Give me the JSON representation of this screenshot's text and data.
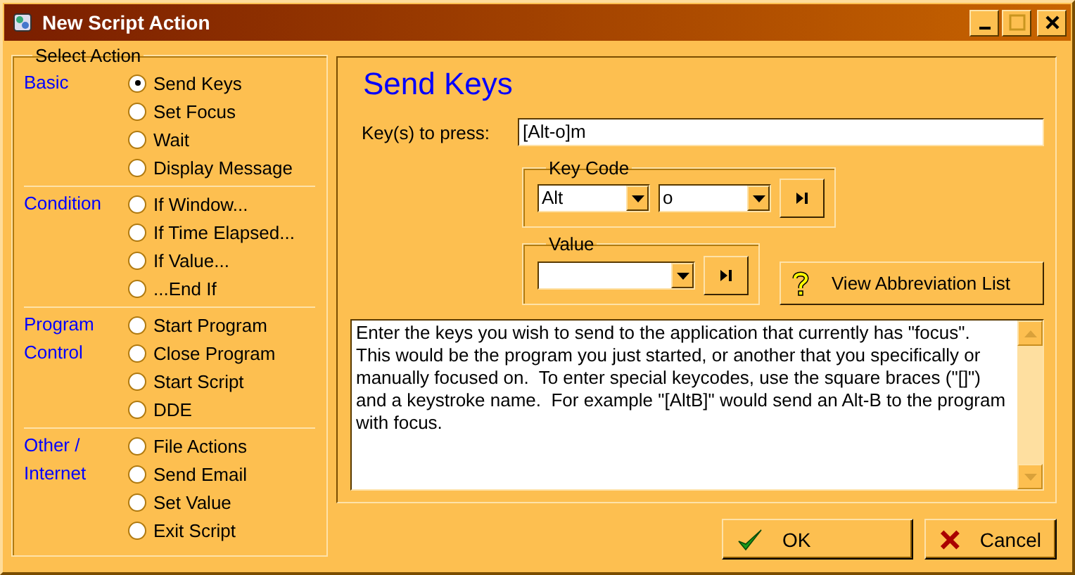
{
  "window": {
    "title": "New Script Action"
  },
  "action_group": {
    "label": "Select Action",
    "sections": [
      {
        "label_lines": [
          "Basic"
        ],
        "options": [
          {
            "label": "Send Keys",
            "selected": true
          },
          {
            "label": "Set Focus",
            "selected": false
          },
          {
            "label": "Wait",
            "selected": false
          },
          {
            "label": "Display Message",
            "selected": false
          }
        ]
      },
      {
        "label_lines": [
          "Condition"
        ],
        "options": [
          {
            "label": "If Window...",
            "selected": false
          },
          {
            "label": "If Time Elapsed...",
            "selected": false
          },
          {
            "label": "If Value...",
            "selected": false
          },
          {
            "label": "...End If",
            "selected": false
          }
        ]
      },
      {
        "label_lines": [
          "Program",
          "Control"
        ],
        "options": [
          {
            "label": "Start Program",
            "selected": false
          },
          {
            "label": "Close Program",
            "selected": false
          },
          {
            "label": "Start Script",
            "selected": false
          },
          {
            "label": "DDE",
            "selected": false
          }
        ]
      },
      {
        "label_lines": [
          "Other /",
          "Internet"
        ],
        "options": [
          {
            "label": "File Actions",
            "selected": false
          },
          {
            "label": "Send Email",
            "selected": false
          },
          {
            "label": "Set Value",
            "selected": false
          },
          {
            "label": "Exit Script",
            "selected": false
          }
        ]
      }
    ]
  },
  "panel": {
    "heading": "Send Keys",
    "keys_label": "Key(s) to press:",
    "keys_value": "[Alt-o]m",
    "key_code": {
      "label": "Key Code",
      "modifier": "Alt",
      "key": "o"
    },
    "value": {
      "label": "Value"
    },
    "abbreviation_button": "View Abbreviation List",
    "description": "Enter the keys you wish to send to the application that currently has \"focus\".  This would be the program you just started, or another that you specifically or manually focused on.  To enter special keycodes, use the square braces (\"[]\") and a keystroke name.  For example \"[AltB]\" would send an Alt-B to the program with focus."
  },
  "buttons": [
    {
      "kind": "ok",
      "label": "OK"
    },
    {
      "kind": "cancel",
      "label": "Cancel"
    }
  ]
}
